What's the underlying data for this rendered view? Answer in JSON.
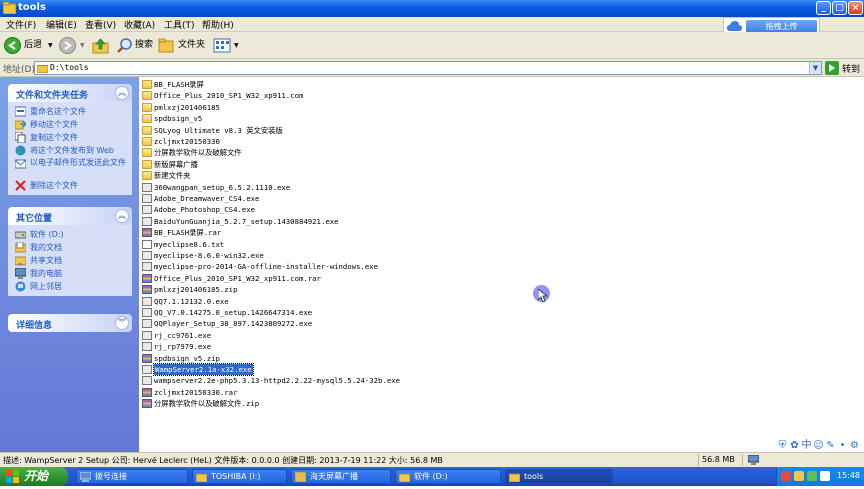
{
  "window": {
    "title": "tools"
  },
  "menu": [
    "文件(F)",
    "编辑(E)",
    "查看(V)",
    "收藏(A)",
    "工具(T)",
    "帮助(H)"
  ],
  "toolbar": {
    "back": "后退",
    "search": "搜索",
    "folders": "文件夹"
  },
  "upload": {
    "label": "拖拽上传"
  },
  "address": {
    "label": "地址(D)",
    "path": "D:\\tools",
    "go": "转到"
  },
  "sidebar": {
    "tasks": {
      "title": "文件和文件夹任务",
      "items": [
        "重命名这个文件",
        "移动这个文件",
        "复制这个文件",
        "将这个文件发布到 Web",
        "以电子邮件形式发送此文件",
        "删除这个文件"
      ]
    },
    "places": {
      "title": "其它位置",
      "items": [
        "软件 (D:)",
        "我的文档",
        "共享文档",
        "我的电脑",
        "网上邻居"
      ]
    },
    "details": {
      "title": "详细信息"
    }
  },
  "files": [
    {
      "name": "BB_FLASH录屏",
      "type": "folder"
    },
    {
      "name": "Office_Plus_2010_SP1_W32_xp911.com",
      "type": "folder"
    },
    {
      "name": "pmlxzj201406185",
      "type": "folder"
    },
    {
      "name": "spdbsign_v5",
      "type": "folder"
    },
    {
      "name": "SQLyog Ultimate v8.3 英文安装版",
      "type": "folder"
    },
    {
      "name": "zcljmxt20150330",
      "type": "folder"
    },
    {
      "name": "分屏教学软件以及破解文件",
      "type": "folder"
    },
    {
      "name": "新版屏幕广播",
      "type": "folder"
    },
    {
      "name": "新建文件夹",
      "type": "folder"
    },
    {
      "name": "360wangpan_setup_6.5.2.1110.exe",
      "type": "exe"
    },
    {
      "name": "Adobe_Dreamwaver_CS4.exe",
      "type": "exe"
    },
    {
      "name": "Adobe_Photoshop_CS4.exe",
      "type": "exe"
    },
    {
      "name": "BaiduYunGuanjia_5.2.7_setup.1430884921.exe",
      "type": "exe"
    },
    {
      "name": "BB_FLASH录屏.rar",
      "type": "rar"
    },
    {
      "name": "myeclipse8.6.txt",
      "type": "txt"
    },
    {
      "name": "myeclipse-8.6.0-win32.exe",
      "type": "exe"
    },
    {
      "name": "myeclipse-pro-2014-GA-offline-installer-windows.exe",
      "type": "exe"
    },
    {
      "name": "Office_Plus_2010_SP1_W32_xp911.com.rar",
      "type": "rar"
    },
    {
      "name": "pmlxzj201406185.zip",
      "type": "rar"
    },
    {
      "name": "QQ7.1.12132.0.exe",
      "type": "exe"
    },
    {
      "name": "QQ_V7.0.14275.0_setup.1426647314.exe",
      "type": "exe"
    },
    {
      "name": "QQPlayer_Setup_38_897.1423809272.exe",
      "type": "exe"
    },
    {
      "name": "rj_cc9761.exe",
      "type": "exe"
    },
    {
      "name": "rj_rp7979.exe",
      "type": "exe"
    },
    {
      "name": "spdbsign_v5.zip",
      "type": "rar"
    },
    {
      "name": "WampServer2.1a-x32.exe",
      "type": "exe",
      "selected": true
    },
    {
      "name": "wampserver2.2e-php5.3.13-httpd2.2.22-mysql5.5.24-32b.exe",
      "type": "exe"
    },
    {
      "name": "zcljmxt20150330.rar",
      "type": "rar"
    },
    {
      "name": "分屏教学软件以及破解文件.zip",
      "type": "rar"
    }
  ],
  "status": {
    "description": "描述: WampServer 2 Setup 公司: Hervé Leclerc (HeL) 文件版本: 0.0.0.0 创建日期: 2013-7-19 11:22 大小: 56.8 MB",
    "size": "56.8 MB"
  },
  "taskbar": {
    "start": "开始",
    "tasks": [
      "拨号连接",
      "TOSHIBA (I:)",
      "海天屏幕广播",
      "软件 (D:)",
      "tools"
    ],
    "clock": "15:48"
  },
  "colors": {
    "xp_blue": "#0A5BE0",
    "sidebar_link": "#215DC6",
    "selection": "#316AC5"
  }
}
